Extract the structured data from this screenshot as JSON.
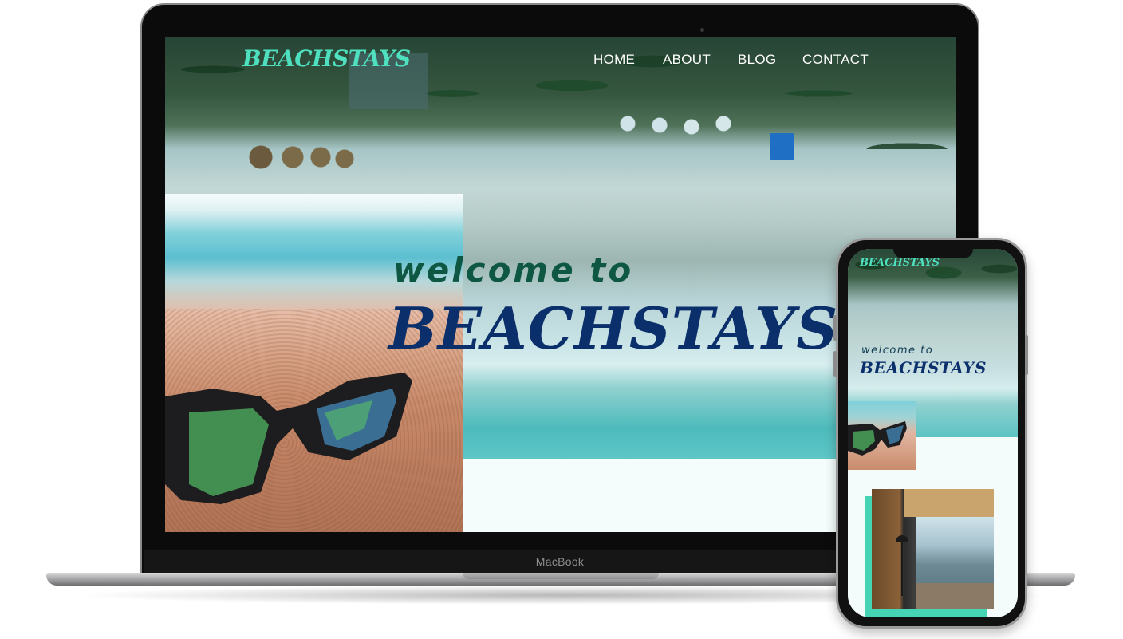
{
  "device_label": "MacBook",
  "site": {
    "logo": "BEACHSTAYS",
    "nav": [
      {
        "label": "HOME"
      },
      {
        "label": "ABOUT"
      },
      {
        "label": "BLOG"
      },
      {
        "label": "CONTACT"
      }
    ],
    "hero": {
      "welcome": "welcome to",
      "brand": "BEACHSTAYS"
    }
  },
  "mobile": {
    "logo": "BEACHSTAYS",
    "welcome": "welcome to",
    "brand": "BEACHSTAYS"
  },
  "colors": {
    "logo_accent": "#4ee0bf",
    "welcome_text": "#0e5743",
    "brand_text": "#0a2f6b",
    "nav_text": "#ffffff",
    "accent_bar": "#45d4b4"
  }
}
